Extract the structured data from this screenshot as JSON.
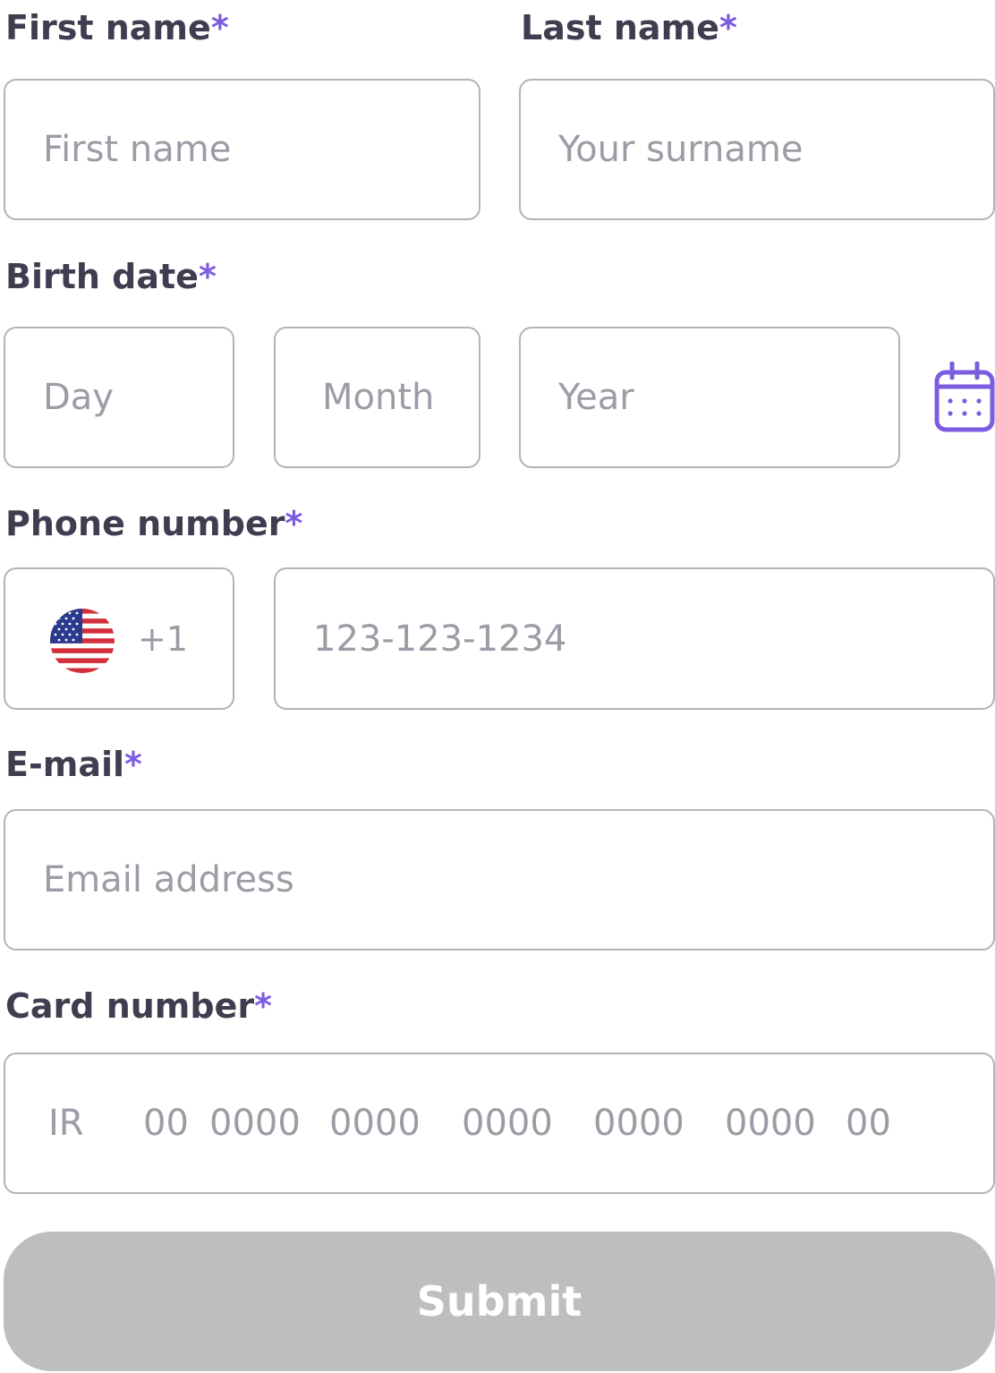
{
  "form": {
    "required_marker": "*",
    "first_name": {
      "label": "First name",
      "placeholder": "First name"
    },
    "last_name": {
      "label": "Last name",
      "placeholder": "Your surname"
    },
    "birth_date": {
      "label": "Birth date",
      "day_placeholder": "Day",
      "month_placeholder": "Month",
      "year_placeholder": "Year",
      "icon": "calendar-icon"
    },
    "phone": {
      "label": "Phone number",
      "country_flag": "us-flag-icon",
      "dial_code": "+1",
      "placeholder": "123-123-1234"
    },
    "email": {
      "label": "E-mail",
      "placeholder": "Email address"
    },
    "card": {
      "label": "Card number",
      "placeholder_parts": [
        "IR",
        "00",
        "0000",
        "0000",
        "0000",
        "0000",
        "0000",
        "00"
      ]
    },
    "submit_label": "Submit"
  },
  "colors": {
    "accent": "#7c5ce0",
    "label_text": "#3f3d4f",
    "placeholder_text": "#9c9ca6",
    "border": "#b4b4b6",
    "button_disabled": "#bebebe",
    "button_text": "#ffffff"
  }
}
